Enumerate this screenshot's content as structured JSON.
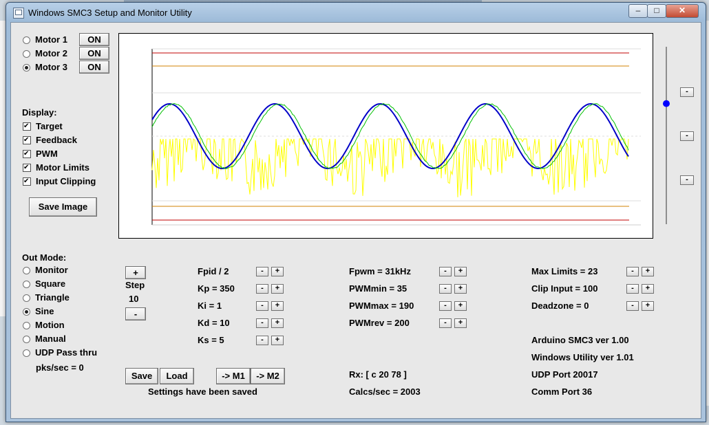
{
  "window": {
    "title": "Windows SMC3 Setup and Monitor Utility",
    "minimize": "–",
    "maximize": "□",
    "close": "✕"
  },
  "motors": [
    {
      "label": "Motor 1",
      "selected": false,
      "on_label": "ON"
    },
    {
      "label": "Motor 2",
      "selected": false,
      "on_label": "ON"
    },
    {
      "label": "Motor 3",
      "selected": true,
      "on_label": "ON"
    }
  ],
  "display": {
    "heading": "Display:",
    "items": [
      {
        "label": "Target",
        "checked": true
      },
      {
        "label": "Feedback",
        "checked": true
      },
      {
        "label": "PWM",
        "checked": true
      },
      {
        "label": "Motor Limits",
        "checked": true
      },
      {
        "label": "Input Clipping",
        "checked": true
      }
    ],
    "save_image": "Save Image"
  },
  "out_mode": {
    "heading": "Out Mode:",
    "items": [
      {
        "label": "Monitor",
        "selected": false
      },
      {
        "label": "Square",
        "selected": false
      },
      {
        "label": "Triangle",
        "selected": false
      },
      {
        "label": "Sine",
        "selected": true
      },
      {
        "label": "Motion",
        "selected": false
      },
      {
        "label": "Manual",
        "selected": false
      },
      {
        "label": "UDP Pass thru",
        "selected": false
      }
    ],
    "pks_sec": "pks/sec = 0"
  },
  "step": {
    "plus": "+",
    "label": "Step",
    "value": "10",
    "minus": "-"
  },
  "pid": [
    "Fpid / 2",
    "Kp = 350",
    "Ki = 1",
    "Kd = 10",
    "Ks = 5"
  ],
  "pwm": [
    "Fpwm = 31kHz",
    "PWMmin = 35",
    "PWMmax = 190",
    "PWMrev = 200"
  ],
  "limits": [
    "Max Limits = 23",
    "Clip Input = 100",
    "Deadzone = 0"
  ],
  "spin": {
    "minus": "-",
    "plus": "+"
  },
  "info": {
    "arduino": "Arduino SMC3 ver 1.00",
    "utility": "Windows Utility ver 1.01",
    "udp": "UDP Port 20017",
    "comm": "Comm Port 36",
    "rx": "Rx: [ c 20 78 ]",
    "calcs": "Calcs/sec = 2003"
  },
  "buttons": {
    "save": "Save",
    "load": "Load",
    "to_m1": "-> M1",
    "to_m2": "-> M2",
    "status": "Settings have been saved"
  },
  "slider": {
    "buttons": [
      "-",
      "-",
      "-"
    ],
    "value_fraction": 0.32
  },
  "colors": {
    "target": "#0000c8",
    "feedback": "#00c000",
    "pwm": "#ffff00",
    "limit": "#c00000",
    "clip": "#d08000",
    "slider_thumb": "#0000ff"
  }
}
